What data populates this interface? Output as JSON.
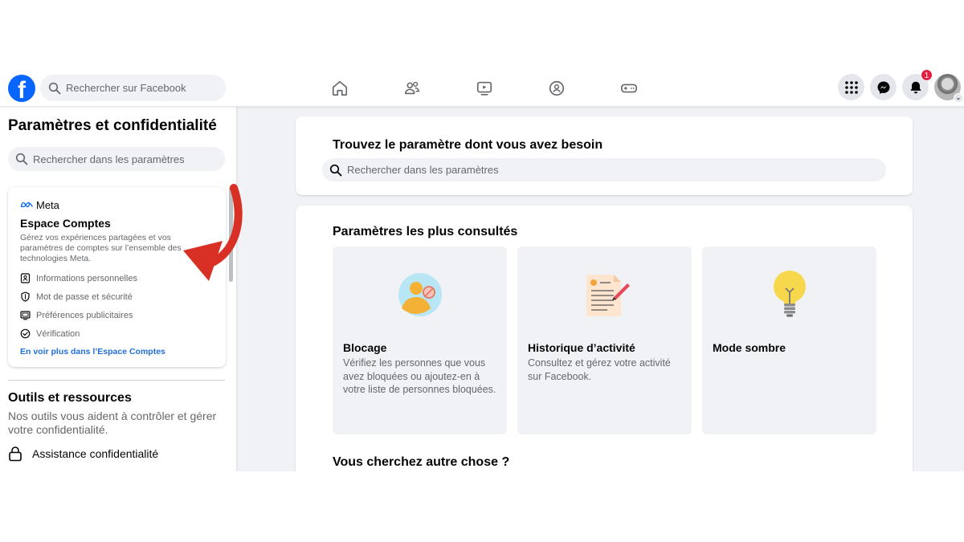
{
  "topbar": {
    "search_placeholder": "Rechercher sur Facebook",
    "nav": [
      {
        "name": "home-icon"
      },
      {
        "name": "friends-icon"
      },
      {
        "name": "watch-icon"
      },
      {
        "name": "groups-icon"
      },
      {
        "name": "gaming-icon"
      }
    ],
    "notifications_count": "1"
  },
  "sidebar": {
    "title": "Paramètres et confidentialité",
    "search_placeholder": "Rechercher dans les paramètres",
    "meta_card": {
      "brand": "Meta",
      "title": "Espace Comptes",
      "description": "Gérez vos expériences partagées et vos paramètres de comptes sur l’ensemble des technologies Meta.",
      "items": [
        {
          "label": "Informations personnelles",
          "icon": "id-card-icon"
        },
        {
          "label": "Mot de passe et sécurité",
          "icon": "shield-icon"
        },
        {
          "label": "Préférences publicitaires",
          "icon": "monitor-icon"
        },
        {
          "label": "Vérification",
          "icon": "check-badge-icon"
        }
      ],
      "link": "En voir plus dans l’Espace Comptes"
    },
    "tools": {
      "title": "Outils et ressources",
      "description": "Nos outils vous aident à contrôler et gérer votre confidentialité.",
      "item": "Assistance confidentialité"
    }
  },
  "main": {
    "finder": {
      "title": "Trouvez le paramètre dont vous avez besoin",
      "search_placeholder": "Rechercher dans les paramètres"
    },
    "popular": {
      "title": "Paramètres les plus consultés",
      "tiles": [
        {
          "title": "Blocage",
          "description": "Vérifiez les personnes que vous avez bloquées ou ajoutez-en à votre liste de personnes bloquées.",
          "icon": "blocking-illustration"
        },
        {
          "title": "Historique d’activité",
          "description": "Consultez et gérez votre activité sur Facebook.",
          "icon": "activity-log-illustration"
        },
        {
          "title": "Mode sombre",
          "description": "",
          "icon": "lightbulb-illustration"
        }
      ],
      "more_title": "Vous cherchez autre chose ?"
    }
  },
  "colors": {
    "brand": "#0866ff",
    "link": "#216fdb",
    "badge": "#e41e3f",
    "annotation_arrow": "#d93025",
    "page_background": "#f0f2f5"
  }
}
